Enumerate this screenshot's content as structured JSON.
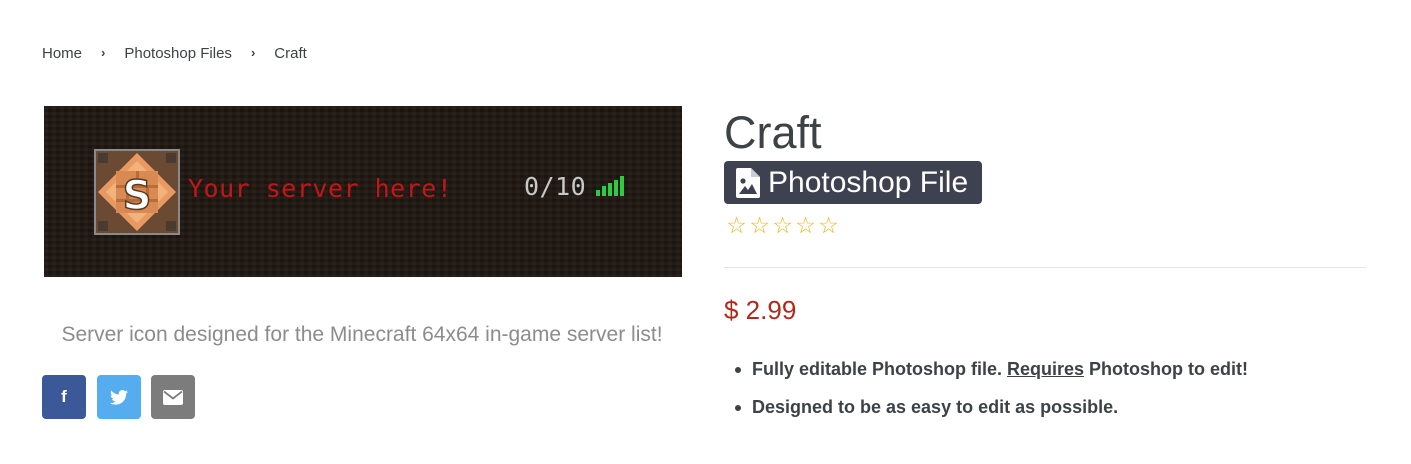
{
  "breadcrumb": {
    "items": [
      "Home",
      "Photoshop Files",
      "Craft"
    ],
    "separator": "›"
  },
  "banner": {
    "motd": "Your server here!",
    "player_count": "0/10",
    "icon_letter": "S"
  },
  "description": "Server icon designed for the Minecraft 64x64 in-game server list!",
  "share": {
    "facebook_label": "f",
    "icons": [
      "facebook-icon",
      "twitter-icon",
      "email-icon"
    ]
  },
  "product": {
    "title": "Craft",
    "type_badge": "Photoshop File",
    "rating": 0,
    "rating_max": 5,
    "price": "$ 2.99",
    "features": [
      {
        "before": "Fully editable Photoshop file. ",
        "underlined": "Requires",
        "after": " Photoshop to edit!"
      },
      {
        "text": "Designed to be as easy to edit as possible."
      }
    ]
  },
  "colors": {
    "price": "#b02a1a",
    "badge_bg": "#3d4150",
    "star": "#e8b614",
    "facebook": "#3b5998",
    "twitter": "#55acee",
    "email": "#7c7c7c",
    "motd": "#c01818",
    "signal": "#2ecc40"
  }
}
